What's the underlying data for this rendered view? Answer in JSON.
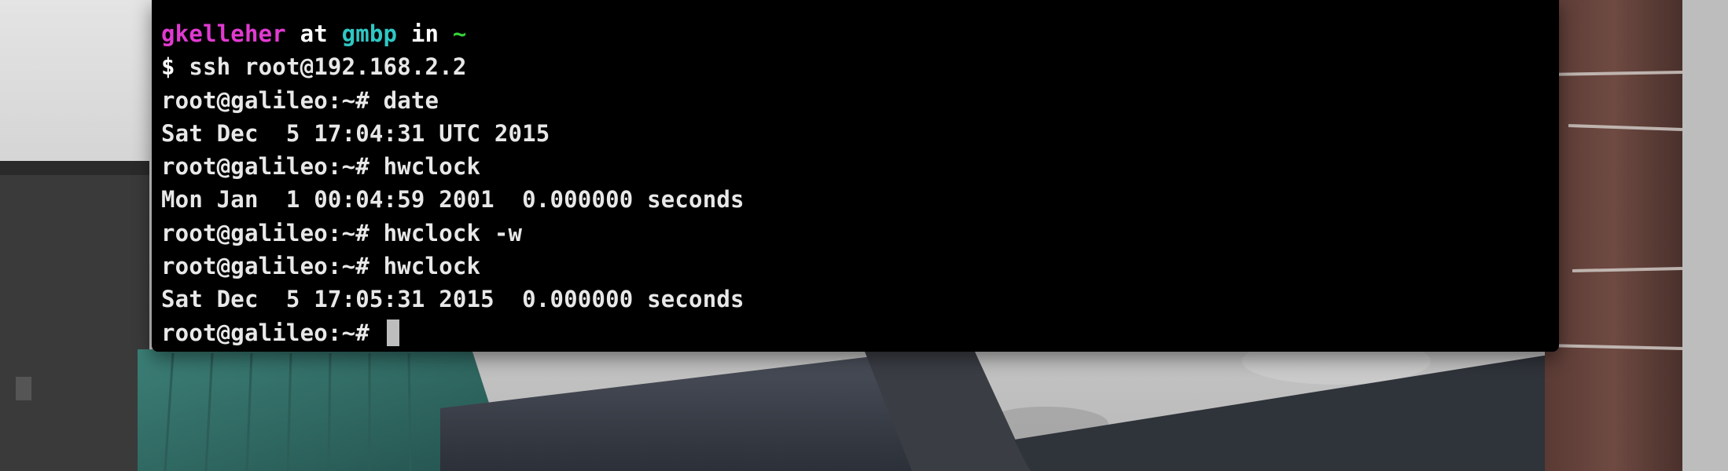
{
  "colors": {
    "terminal_bg": "#000000",
    "text": "#e8e8e8",
    "user": "#e13ad0",
    "host": "#2fc7c4",
    "path": "#36d23a",
    "cursor": "#bdbdbd"
  },
  "wallpaper": {
    "description_icon": "photo-wallpaper"
  },
  "terminal": {
    "prompt_header": {
      "user": "gkelleher",
      "at": " at ",
      "host": "gmbp",
      "in": " in ",
      "path": "~"
    },
    "lines": [
      {
        "kind": "command",
        "prompt": "$ ",
        "text": "ssh root@192.168.2.2"
      },
      {
        "kind": "command",
        "prompt": "root@galileo:~# ",
        "text": "date"
      },
      {
        "kind": "output",
        "text": "Sat Dec  5 17:04:31 UTC 2015"
      },
      {
        "kind": "command",
        "prompt": "root@galileo:~# ",
        "text": "hwclock"
      },
      {
        "kind": "output",
        "text": "Mon Jan  1 00:04:59 2001  0.000000 seconds"
      },
      {
        "kind": "command",
        "prompt": "root@galileo:~# ",
        "text": "hwclock -w"
      },
      {
        "kind": "command",
        "prompt": "root@galileo:~# ",
        "text": "hwclock"
      },
      {
        "kind": "output",
        "text": "Sat Dec  5 17:05:31 2015  0.000000 seconds"
      }
    ],
    "active_prompt": "root@galileo:~# "
  }
}
